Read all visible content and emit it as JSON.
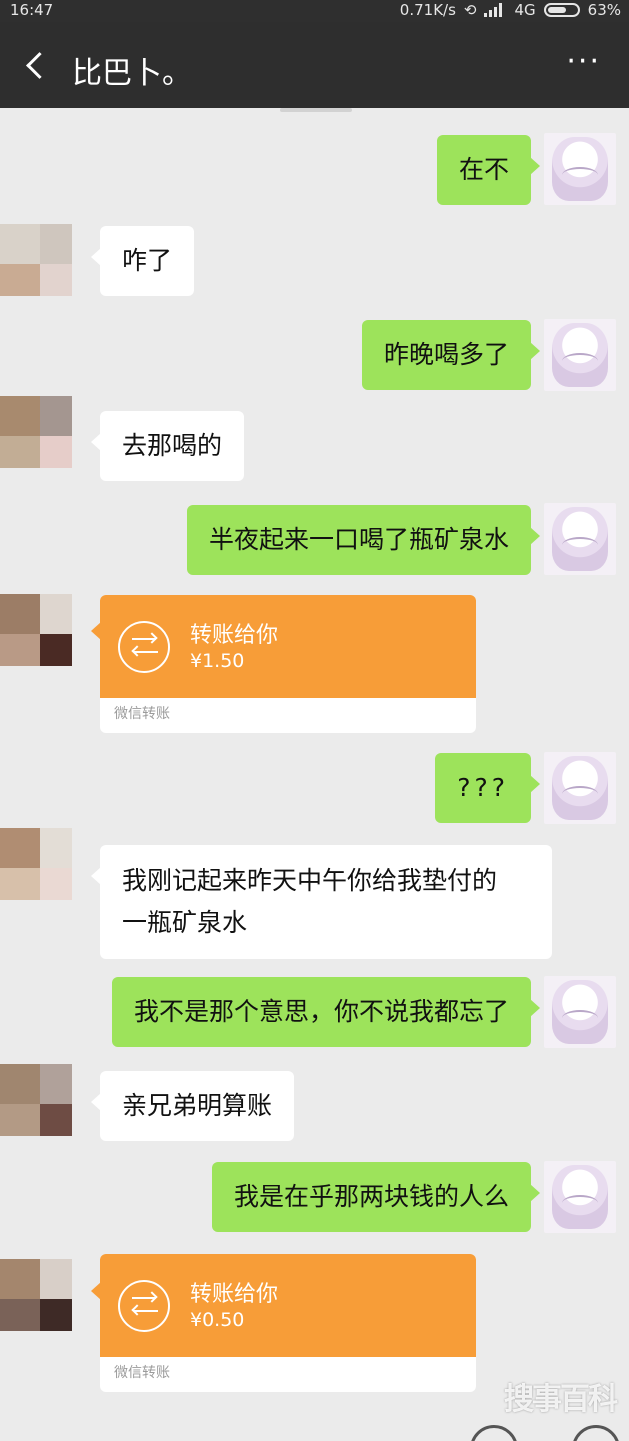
{
  "status_bar": {
    "time": "16:47",
    "speed": "0.71K/s",
    "network": "4G",
    "battery": "63%"
  },
  "nav": {
    "title": "比巴卜。",
    "more": "···"
  },
  "messages": [
    {
      "side": "me",
      "text": "在不"
    },
    {
      "side": "friend",
      "text": "咋了"
    },
    {
      "side": "me",
      "text": "昨晚喝多了"
    },
    {
      "side": "friend",
      "text": "去那喝的"
    },
    {
      "side": "me",
      "text": "半夜起来一口喝了瓶矿泉水"
    },
    {
      "side": "friend",
      "type": "transfer",
      "label": "转账给你",
      "amount": "¥1.50",
      "footer": "微信转账"
    },
    {
      "side": "me",
      "text": "???"
    },
    {
      "side": "friend",
      "text_line1": "我刚记起来昨天中午你给我垫付的",
      "text_line2": "一瓶矿泉水"
    },
    {
      "side": "me",
      "text": "我不是那个意思，你不说我都忘了"
    },
    {
      "side": "friend",
      "text": "亲兄弟明算账"
    },
    {
      "side": "me",
      "text": "我是在乎那两块钱的人么"
    },
    {
      "side": "friend",
      "type": "transfer",
      "label": "转账给你",
      "amount": "¥0.50",
      "footer": "微信转账"
    }
  ],
  "watermark": "搜事百科",
  "colors": {
    "my_bubble": "#9de35b",
    "friend_bubble": "#ffffff",
    "transfer": "#f79d38",
    "background": "#ebebeb",
    "nav_bar": "#2e2e2e"
  },
  "icons": [
    "back-chevron-icon",
    "more-dots-icon",
    "transfer-arrows-icon",
    "battery-icon",
    "signal-icon"
  ]
}
